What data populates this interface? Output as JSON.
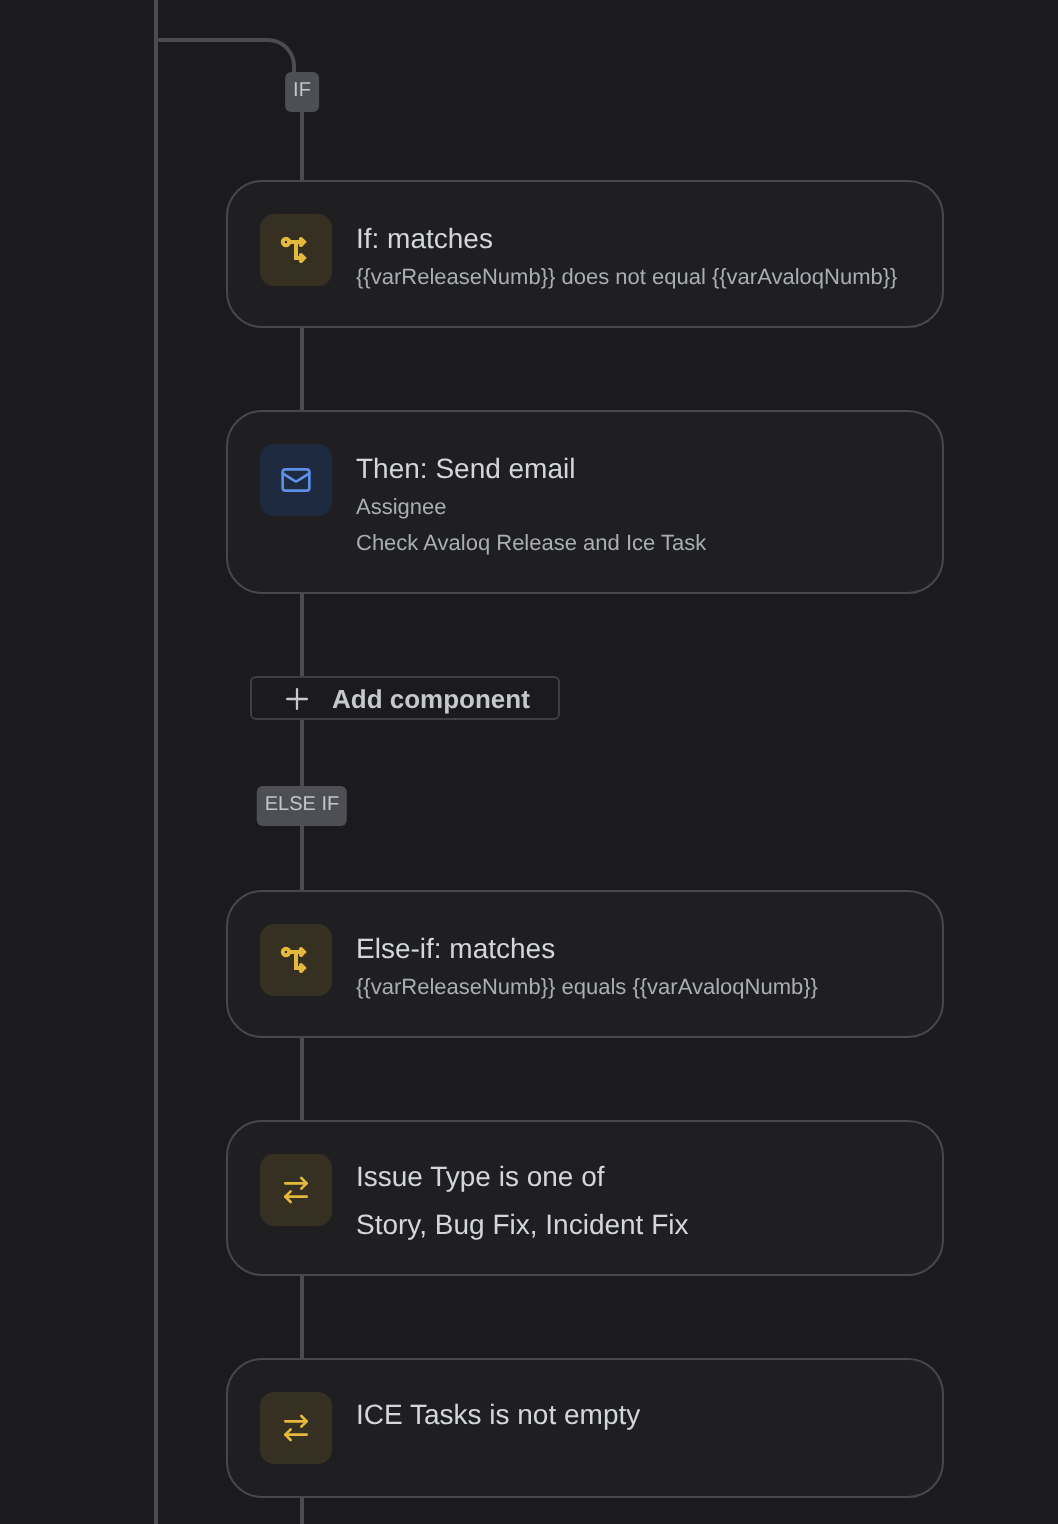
{
  "flow": [
    {
      "kind": "badge",
      "label": "IF"
    },
    {
      "kind": "condition",
      "title": "If: matches",
      "lines": [
        "{{varReleaseNumb}} does not equal {{varAvaloqNumb}}"
      ]
    },
    {
      "kind": "email",
      "title": "Then: Send email",
      "lines": [
        "Assignee",
        "Check Avaloq Release and Ice Task"
      ]
    },
    {
      "kind": "add",
      "label": "Add component"
    },
    {
      "kind": "badge",
      "label": "ELSE IF"
    },
    {
      "kind": "condition",
      "title": "Else-if: matches",
      "lines": [
        "{{varReleaseNumb}} equals {{varAvaloqNumb}}"
      ]
    },
    {
      "kind": "filter",
      "title": "Issue Type is one of",
      "lines": [
        "Story, Bug Fix, Incident Fix"
      ]
    },
    {
      "kind": "filter",
      "title": "ICE Tasks is not empty"
    }
  ]
}
